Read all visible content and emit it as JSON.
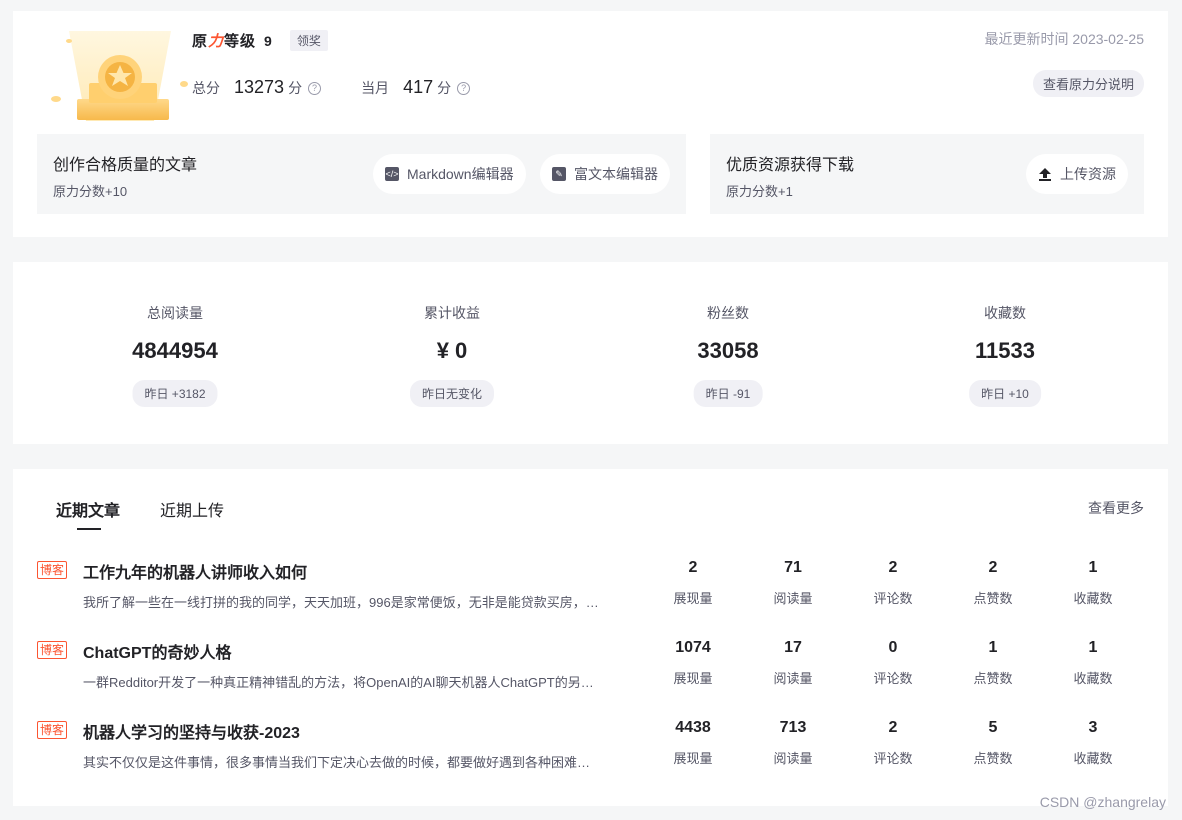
{
  "level": {
    "logo_black": "原",
    "logo_red": "力",
    "logo_rest": "等级",
    "number": "9",
    "claim_label": "领奖",
    "total_label": "总分",
    "total_value": "13273",
    "month_label": "当月",
    "month_value": "417",
    "unit": "分",
    "update_time": "最近更新时间 2023-02-25",
    "explain_label": "查看原力分说明"
  },
  "tasks": [
    {
      "title": "创作合格质量的文章",
      "sub": "原力分数+10",
      "buttons": [
        "Markdown编辑器",
        "富文本编辑器"
      ]
    },
    {
      "title": "优质资源获得下载",
      "sub": "原力分数+1",
      "buttons": [
        "上传资源"
      ]
    }
  ],
  "stats": [
    {
      "label": "总阅读量",
      "value": "4844954",
      "delta": "昨日 +3182"
    },
    {
      "label": "累计收益",
      "value": "¥ 0",
      "delta": "昨日无变化"
    },
    {
      "label": "粉丝数",
      "value": "33058",
      "delta": "昨日 -91"
    },
    {
      "label": "收藏数",
      "value": "11533",
      "delta": "昨日 +10"
    }
  ],
  "recent": {
    "tabs": [
      "近期文章",
      "近期上传"
    ],
    "more": "查看更多",
    "tag": "博客",
    "metric_labels": [
      "展现量",
      "阅读量",
      "评论数",
      "点赞数",
      "收藏数"
    ],
    "articles": [
      {
        "title": "工作九年的机器人讲师收入如何",
        "desc": "我所了解一些在一线打拼的我的同学，天天加班，996是家常便饭，无非是能贷款买房，有个小家，生活也过得不是很如意",
        "metrics": [
          "2",
          "71",
          "2",
          "2",
          "1"
        ]
      },
      {
        "title": "ChatGPT的奇妙人格",
        "desc": "一群Redditor开发了一种真正精神错乱的方法，将OpenAI的AI聊天机器人ChatGPT的另一个人格召唤出来",
        "metrics": [
          "1074",
          "17",
          "0",
          "1",
          "1"
        ]
      },
      {
        "title": "机器人学习的坚持与收获-2023",
        "desc": "其实不仅仅是这件事情，很多事情当我们下定决心去做的时候，都要做好遇到各种困难的准备",
        "metrics": [
          "4438",
          "713",
          "2",
          "5",
          "3"
        ]
      }
    ]
  },
  "watermark": "CSDN @zhangrelay"
}
